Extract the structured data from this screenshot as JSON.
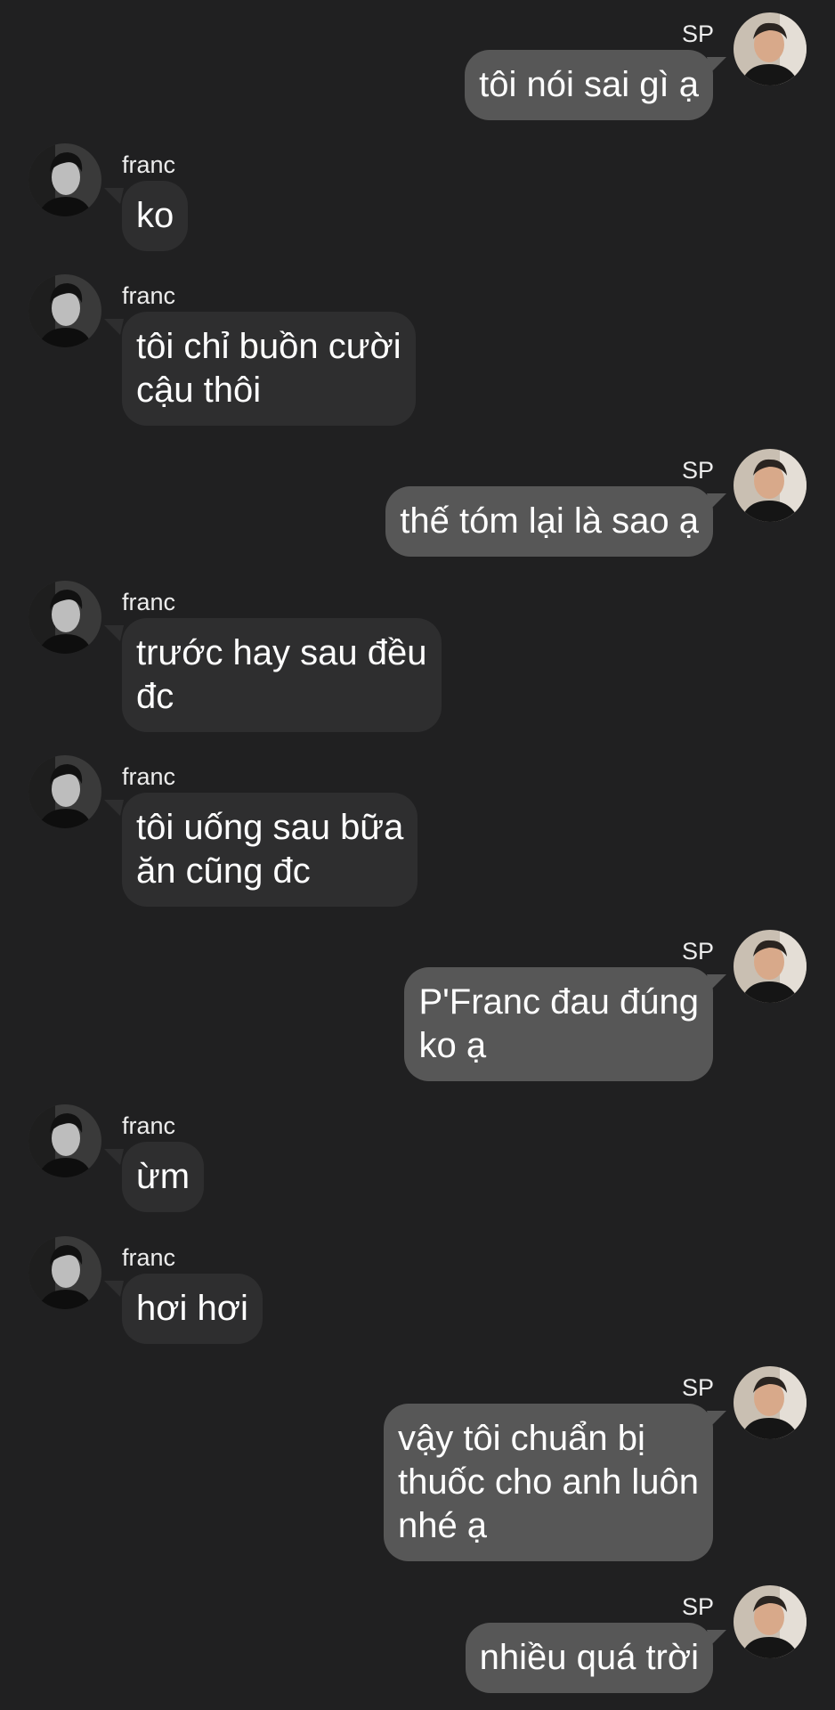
{
  "chat": {
    "messages": [
      {
        "sender": "SP",
        "side": "right",
        "text": "tôi nói sai gì ạ"
      },
      {
        "sender": "franc",
        "side": "left",
        "text": "ko"
      },
      {
        "sender": "franc",
        "side": "left",
        "text": "tôi chỉ buồn cười\ncậu thôi"
      },
      {
        "sender": "SP",
        "side": "right",
        "text": "thế tóm lại là sao ạ"
      },
      {
        "sender": "franc",
        "side": "left",
        "text": "trước hay sau đều\nđc"
      },
      {
        "sender": "franc",
        "side": "left",
        "text": "tôi uống sau bữa\năn cũng đc"
      },
      {
        "sender": "SP",
        "side": "right",
        "text": "P'Franc đau đúng\nko ạ"
      },
      {
        "sender": "franc",
        "side": "left",
        "text": "ừm"
      },
      {
        "sender": "franc",
        "side": "left",
        "text": "hơi hơi"
      },
      {
        "sender": "SP",
        "side": "right",
        "text": "vậy tôi chuẩn bị\nthuốc cho anh luôn\nnhé ạ"
      },
      {
        "sender": "SP",
        "side": "right",
        "text": "nhiều quá trời"
      }
    ]
  },
  "colors": {
    "background": "#202021",
    "right_bubble": "#575757",
    "left_bubble": "#2e2e2f",
    "text": "#ffffff"
  },
  "icons": {
    "sp_avatar": "avatar-photo-smiling-man",
    "franc_avatar": "avatar-photo-monochrome-man"
  }
}
